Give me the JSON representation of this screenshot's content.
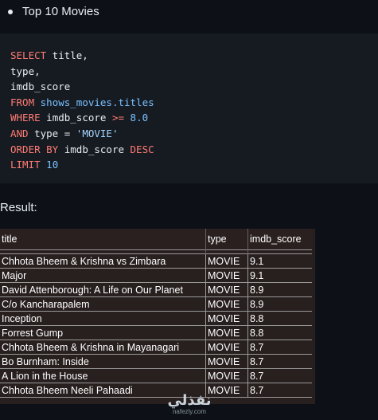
{
  "heading": {
    "text": "Top 10 Movies"
  },
  "code": {
    "lines": [
      [
        {
          "cls": "kw",
          "text": "SELECT"
        },
        {
          "cls": "plain",
          "text": " title,"
        }
      ],
      [
        {
          "cls": "plain",
          "text": "type,"
        }
      ],
      [
        {
          "cls": "plain",
          "text": "imdb_score"
        }
      ],
      [
        {
          "cls": "kw",
          "text": "FROM"
        },
        {
          "cls": "plain",
          "text": " "
        },
        {
          "cls": "ident",
          "text": "shows_movies.titles"
        }
      ],
      [
        {
          "cls": "kw",
          "text": "WHERE"
        },
        {
          "cls": "plain",
          "text": " imdb_score "
        },
        {
          "cls": "kw",
          "text": ">="
        },
        {
          "cls": "plain",
          "text": " "
        },
        {
          "cls": "num",
          "text": "8.0"
        }
      ],
      [
        {
          "cls": "kw",
          "text": "AND"
        },
        {
          "cls": "plain",
          "text": " type = "
        },
        {
          "cls": "str",
          "text": "'MOVIE'"
        }
      ],
      [
        {
          "cls": "kw",
          "text": "ORDER BY"
        },
        {
          "cls": "plain",
          "text": " imdb_score "
        },
        {
          "cls": "kw",
          "text": "DESC"
        }
      ],
      [
        {
          "cls": "kw",
          "text": "LIMIT"
        },
        {
          "cls": "plain",
          "text": " "
        },
        {
          "cls": "num",
          "text": "10"
        }
      ]
    ]
  },
  "result": {
    "label": "Result:"
  },
  "table": {
    "headers": [
      "title",
      "type",
      "imdb_score"
    ],
    "rows": [
      [
        "Chhota Bheem & Krishna vs Zimbara",
        "MOVIE",
        "9.1"
      ],
      [
        "Major",
        "MOVIE",
        "9.1"
      ],
      [
        "David Attenborough: A Life on Our Planet",
        "MOVIE",
        "8.9"
      ],
      [
        "C/o Kancharapalem",
        "MOVIE",
        "8.9"
      ],
      [
        "Inception",
        "MOVIE",
        "8.8"
      ],
      [
        "Forrest Gump",
        "MOVIE",
        "8.8"
      ],
      [
        "Chhota Bheem & Krishna in Mayanagari",
        "MOVIE",
        "8.7"
      ],
      [
        "Bo Burnham: Inside",
        "MOVIE",
        "8.7"
      ],
      [
        "A Lion in the House",
        "MOVIE",
        "8.7"
      ],
      [
        "Chhota Bheem Neeli Pahaadi",
        "MOVIE",
        "8.7"
      ]
    ]
  },
  "watermark": {
    "logo": "نفذلي",
    "url": "nafezly.com"
  }
}
